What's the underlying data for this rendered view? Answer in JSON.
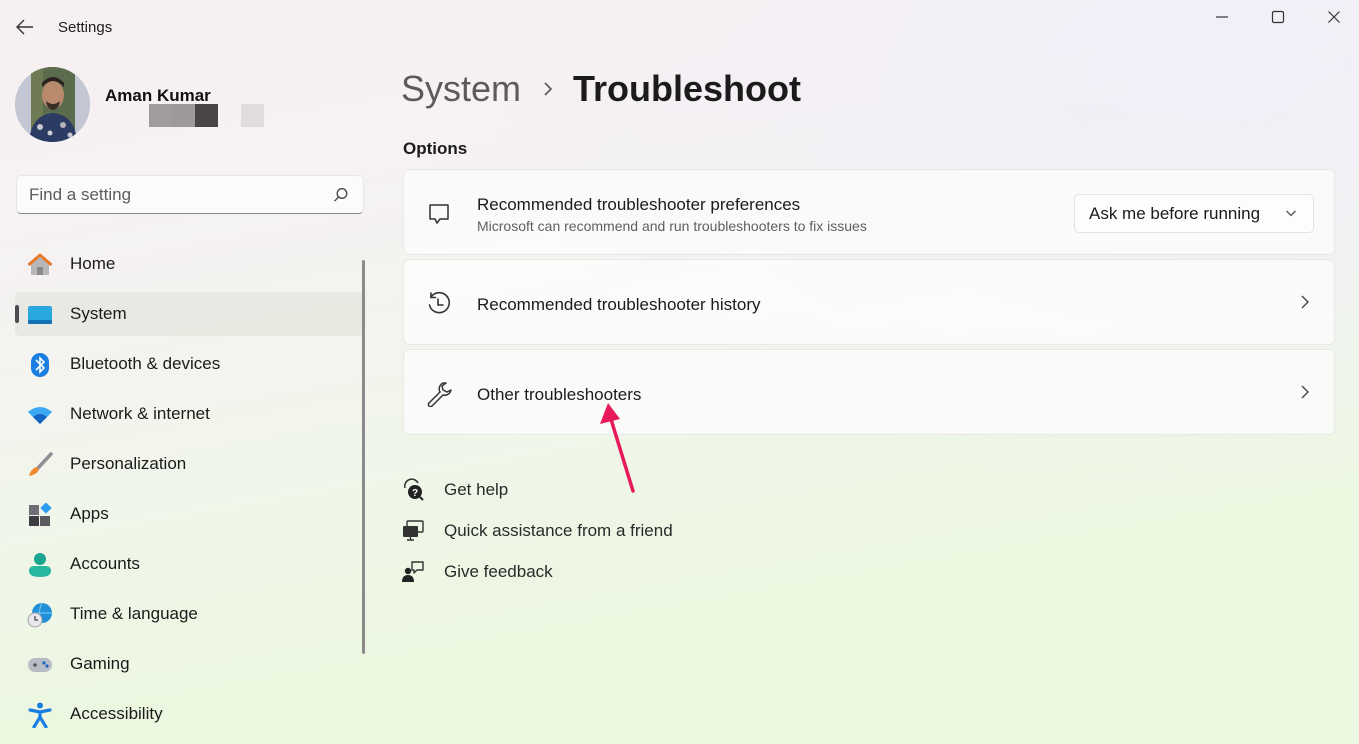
{
  "window": {
    "title": "Settings",
    "controls": {
      "minimize": "minimize-icon",
      "maximize": "maximize-icon",
      "close": "close-icon"
    }
  },
  "profile": {
    "name": "Aman Kumar",
    "email_redacted": true
  },
  "search": {
    "placeholder": "Find a setting",
    "value": ""
  },
  "sidebar": {
    "items": [
      {
        "label": "Home",
        "icon": "home-icon",
        "active": false
      },
      {
        "label": "System",
        "icon": "system-icon",
        "active": true
      },
      {
        "label": "Bluetooth & devices",
        "icon": "bluetooth-icon",
        "active": false
      },
      {
        "label": "Network & internet",
        "icon": "wifi-icon",
        "active": false
      },
      {
        "label": "Personalization",
        "icon": "paintbrush-icon",
        "active": false
      },
      {
        "label": "Apps",
        "icon": "apps-icon",
        "active": false
      },
      {
        "label": "Accounts",
        "icon": "account-icon",
        "active": false
      },
      {
        "label": "Time & language",
        "icon": "globe-clock-icon",
        "active": false
      },
      {
        "label": "Gaming",
        "icon": "gamepad-icon",
        "active": false
      },
      {
        "label": "Accessibility",
        "icon": "accessibility-icon",
        "active": false
      }
    ]
  },
  "main": {
    "breadcrumb": {
      "parent": "System",
      "current": "Troubleshoot"
    },
    "section_title": "Options",
    "cards": [
      {
        "title": "Recommended troubleshooter preferences",
        "subtitle": "Microsoft can recommend and run troubleshooters to fix issues",
        "icon": "chat-bubble-icon",
        "dropdown": {
          "value": "Ask me before running"
        }
      },
      {
        "title": "Recommended troubleshooter history",
        "icon": "history-icon"
      },
      {
        "title": "Other troubleshooters",
        "icon": "wrench-icon"
      }
    ],
    "links": [
      {
        "label": "Get help",
        "icon": "help-icon"
      },
      {
        "label": "Quick assistance from a friend",
        "icon": "remote-assist-icon"
      },
      {
        "label": "Give feedback",
        "icon": "feedback-icon"
      }
    ]
  },
  "colors": {
    "annotation_arrow": "#e8195a",
    "system_accent": "#1a9fd9"
  }
}
